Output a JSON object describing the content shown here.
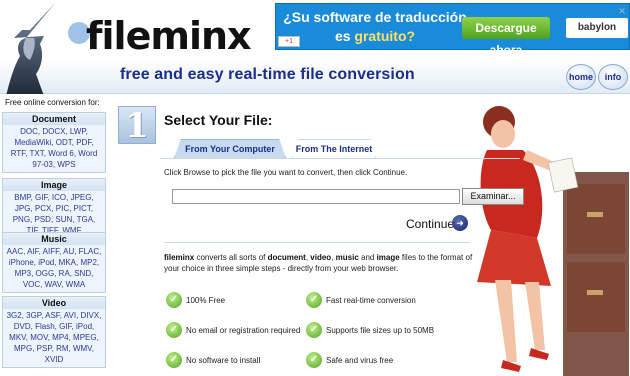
{
  "header": {
    "logo": "fileminx",
    "tagline": "free and easy real-time file conversion",
    "nav": [
      {
        "label": "home"
      },
      {
        "label": "info"
      }
    ]
  },
  "ad": {
    "line1": "¿Su software de traducción",
    "line2_prefix": "es ",
    "line2_highlight": "gratuito?",
    "button": "Descargue ahora",
    "brand": "babylon",
    "gplus": "+1"
  },
  "sidebar": {
    "intro": "Free online conversion for:",
    "sections": [
      {
        "title": "Document",
        "links": "DOC, DOCX, LWP, MediaWiki, ODT, PDF, RTF, TXT, Word 6, Word 97-03, WPS"
      },
      {
        "title": "Image",
        "links": "BMP, GIF, ICO, JPEG, JPG, PCX, PIC, PICT, PNG, PSD, SUN, TGA, TIF, TIFF, WMF"
      },
      {
        "title": "Music",
        "links": "AAC, AIF, AIFF, AU, FLAC, iPhone, iPod, MKA, MP2, MP3, OGG, RA, SND, VOC, WAV, WMA"
      },
      {
        "title": "Video",
        "links": "3G2, 3GP, ASF, AVI, DIVX, DVD, Flash, GIF, iPod, MKV, MOV, MP4, MPEG, MPG, PSP, RM, WMV, XVID"
      }
    ]
  },
  "main": {
    "step_number": "1",
    "step_title": "Select Your File:",
    "tabs": [
      {
        "label": "From Your Computer"
      },
      {
        "label": "From The Internet"
      }
    ],
    "instructions": "Click Browse to pick the file you want to convert, then click Continue.",
    "file_value": "",
    "browse_label": "Examinar...",
    "continue_label": "Continue",
    "description": {
      "p1": "fileminx",
      "p2": " converts all sorts of ",
      "p3": "document",
      "p4": ", ",
      "p5": "video",
      "p6": ", ",
      "p7": "music",
      "p8": " and ",
      "p9": "image",
      "p10": " files to the format of your choice in three simple steps - directly from your web browser."
    },
    "features": [
      {
        "label": "100% Free"
      },
      {
        "label": "Fast real-time conversion"
      },
      {
        "label": "No email or registration required"
      },
      {
        "label": "Supports file sizes up to 50MB"
      },
      {
        "label": "No software to install"
      },
      {
        "label": "Safe and virus free"
      }
    ]
  }
}
